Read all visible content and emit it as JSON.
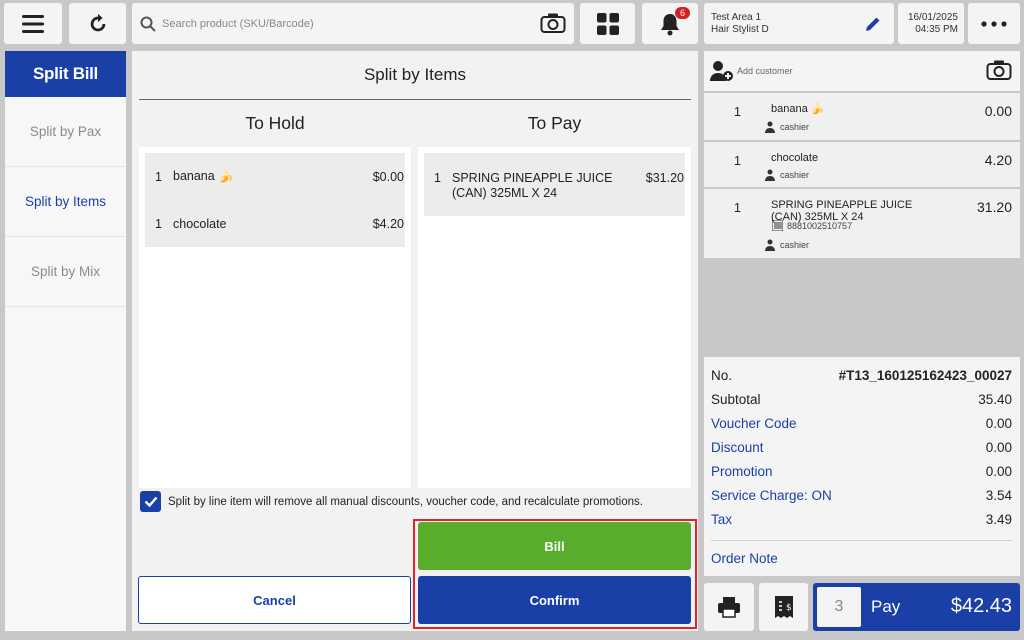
{
  "search": {
    "placeholder": "Search product (SKU/Barcode)"
  },
  "notifications": {
    "count": "6"
  },
  "staff": {
    "area": "Test Area 1",
    "role": "Hair Stylist D"
  },
  "datetime": {
    "date": "16/01/2025",
    "time": "04:35 PM"
  },
  "left_nav": {
    "title": "Split Bill",
    "items": [
      {
        "label": "Split by Pax"
      },
      {
        "label": "Split by Items"
      },
      {
        "label": "Split by Mix"
      }
    ],
    "active": "Split by Items"
  },
  "modal": {
    "title": "Split by Items",
    "hold_header": "To Hold",
    "pay_header": "To Pay",
    "hold_items": [
      {
        "qty": "1",
        "name": "banana 🍌",
        "price": "$0.00"
      },
      {
        "qty": "1",
        "name": "chocolate",
        "price": "$4.20"
      }
    ],
    "pay_items": [
      {
        "qty": "1",
        "name": "SPRING PINEAPPLE JUICE (CAN) 325ML X 24",
        "price": "$31.20"
      }
    ],
    "checkbox_label": "Split by line item will remove all manual discounts, voucher code, and recalculate promotions.",
    "checkbox_checked": true,
    "bill_label": "Bill",
    "cancel_label": "Cancel",
    "confirm_label": "Confirm"
  },
  "customer": {
    "add_label": "Add customer"
  },
  "order_items": [
    {
      "qty": "1",
      "name": "banana 🍌",
      "price": "0.00",
      "staff": "cashier"
    },
    {
      "qty": "1",
      "name": "chocolate",
      "price": "4.20",
      "staff": "cashier"
    },
    {
      "qty": "1",
      "name": "SPRING PINEAPPLE JUICE (CAN) 325ML X 24",
      "barcode": "8881002510757",
      "price": "31.20",
      "staff": "cashier"
    }
  ],
  "summary": {
    "no_label": "No.",
    "no_value": "#T13_160125162423_00027",
    "subtotal_label": "Subtotal",
    "subtotal_value": "35.40",
    "voucher_label": "Voucher Code",
    "voucher_value": "0.00",
    "discount_label": "Discount",
    "discount_value": "0.00",
    "promotion_label": "Promotion",
    "promotion_value": "0.00",
    "service_label": "Service Charge: ON",
    "service_value": "3.54",
    "tax_label": "Tax",
    "tax_value": "3.49",
    "order_note_label": "Order Note"
  },
  "pay": {
    "count": "3",
    "label": "Pay",
    "total": "$42.43"
  },
  "colors": {
    "primary": "#1a3fa6",
    "bill_green": "#59ad2c",
    "highlight_red": "#e32424",
    "badge_red": "#d52020"
  }
}
